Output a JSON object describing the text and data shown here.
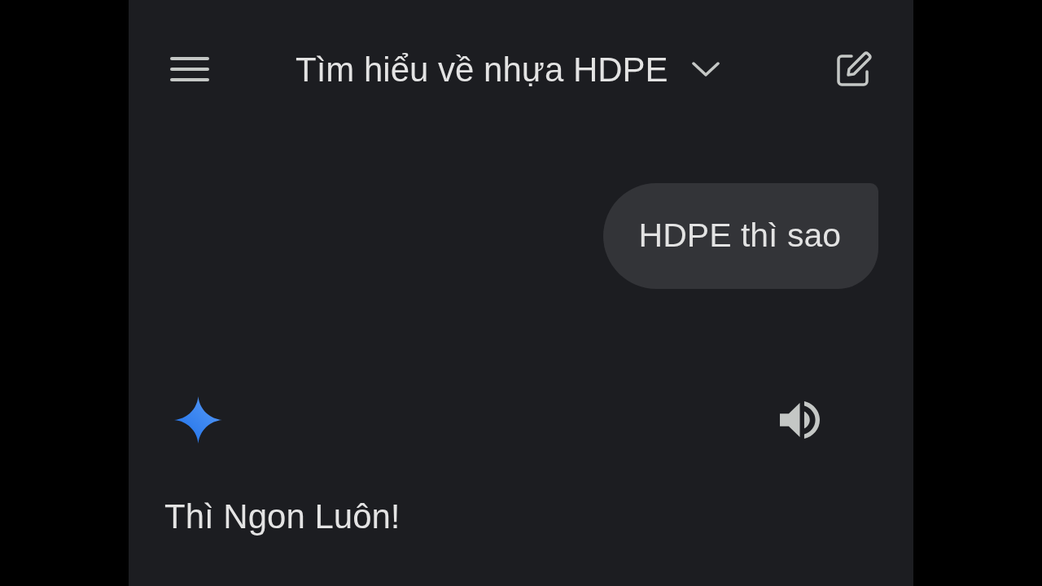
{
  "header": {
    "title": "Tìm hiểu về nhựa HDPE"
  },
  "messages": [
    {
      "kind": "user",
      "text": "HDPE thì sao"
    },
    {
      "kind": "assistant",
      "text": "Thì Ngon Luôn!"
    }
  ]
}
